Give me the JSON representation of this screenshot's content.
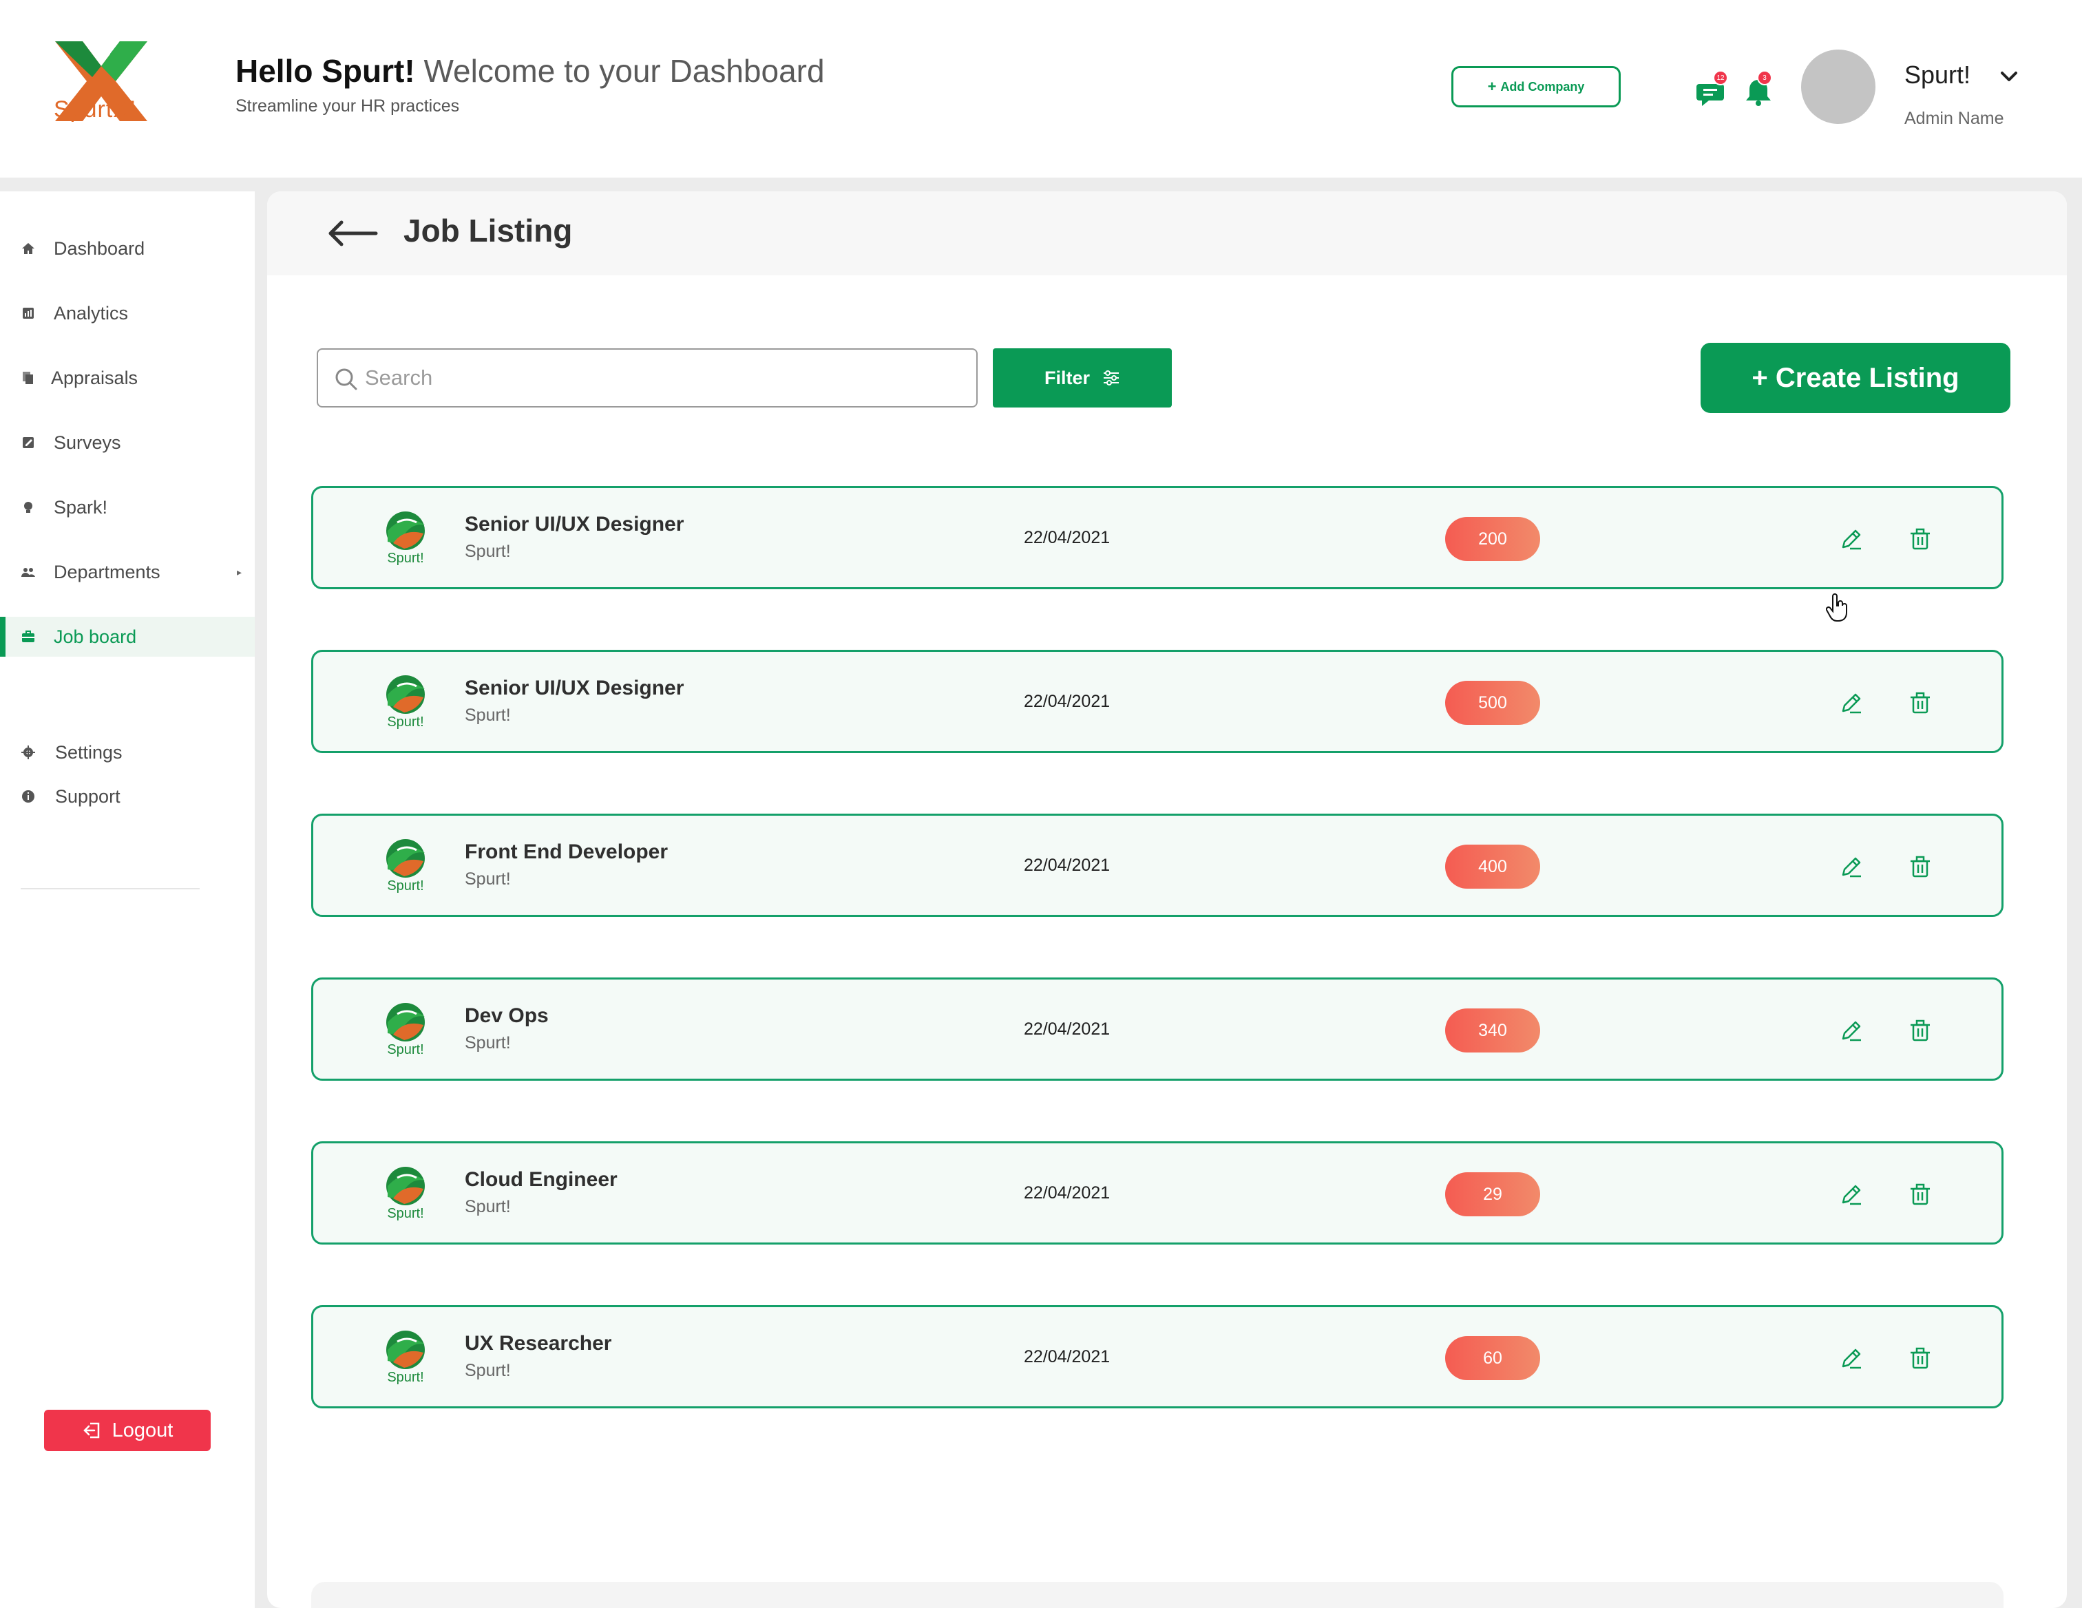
{
  "header": {
    "logo_text": "SpurtX!",
    "greeting_bold": "Hello Spurt!",
    "greeting_light": "Welcome to your Dashboard",
    "subtitle": "Streamline your HR practices",
    "add_company_label": "Add Company",
    "messages_badge": "12",
    "notifications_badge": "3",
    "user_name": "Spurt!",
    "user_role": "Admin Name",
    "accent": "#0a9a55",
    "badge_color": "#f0354b"
  },
  "sidebar": {
    "items": [
      {
        "label": "Dashboard",
        "icon": "home-icon"
      },
      {
        "label": "Analytics",
        "icon": "analytics-icon"
      },
      {
        "label": "Appraisals",
        "icon": "documents-icon"
      },
      {
        "label": "Surveys",
        "icon": "survey-icon"
      },
      {
        "label": "Spark!",
        "icon": "spark-icon"
      },
      {
        "label": "Departments",
        "icon": "people-icon"
      },
      {
        "label": "Job board",
        "icon": "briefcase-icon",
        "active": true
      }
    ],
    "secondary": [
      {
        "label": "Settings",
        "icon": "gear-icon"
      },
      {
        "label": "Support",
        "icon": "info-icon"
      }
    ],
    "logout_label": "Logout"
  },
  "main": {
    "title": "Job Listing",
    "search_placeholder": "Search",
    "filter_label": "Filter",
    "create_label": "+ Create Listing",
    "jobs": [
      {
        "title": "Senior UI/UX Designer",
        "company": "Spurt!",
        "logo_text": "Spurt!",
        "date": "22/04/2021",
        "count": "200"
      },
      {
        "title": "Senior UI/UX Designer",
        "company": "Spurt!",
        "logo_text": "Spurt!",
        "date": "22/04/2021",
        "count": "500"
      },
      {
        "title": "Front End Developer",
        "company": "Spurt!",
        "logo_text": "Spurt!",
        "date": "22/04/2021",
        "count": "400"
      },
      {
        "title": "Dev Ops",
        "company": "Spurt!",
        "logo_text": "Spurt!",
        "date": "22/04/2021",
        "count": "340"
      },
      {
        "title": "Cloud Engineer",
        "company": "Spurt!",
        "logo_text": "Spurt!",
        "date": "22/04/2021",
        "count": "29"
      },
      {
        "title": "UX Researcher",
        "company": "Spurt!",
        "logo_text": "Spurt!",
        "date": "22/04/2021",
        "count": "60"
      }
    ],
    "count_color": "#f45c52"
  }
}
